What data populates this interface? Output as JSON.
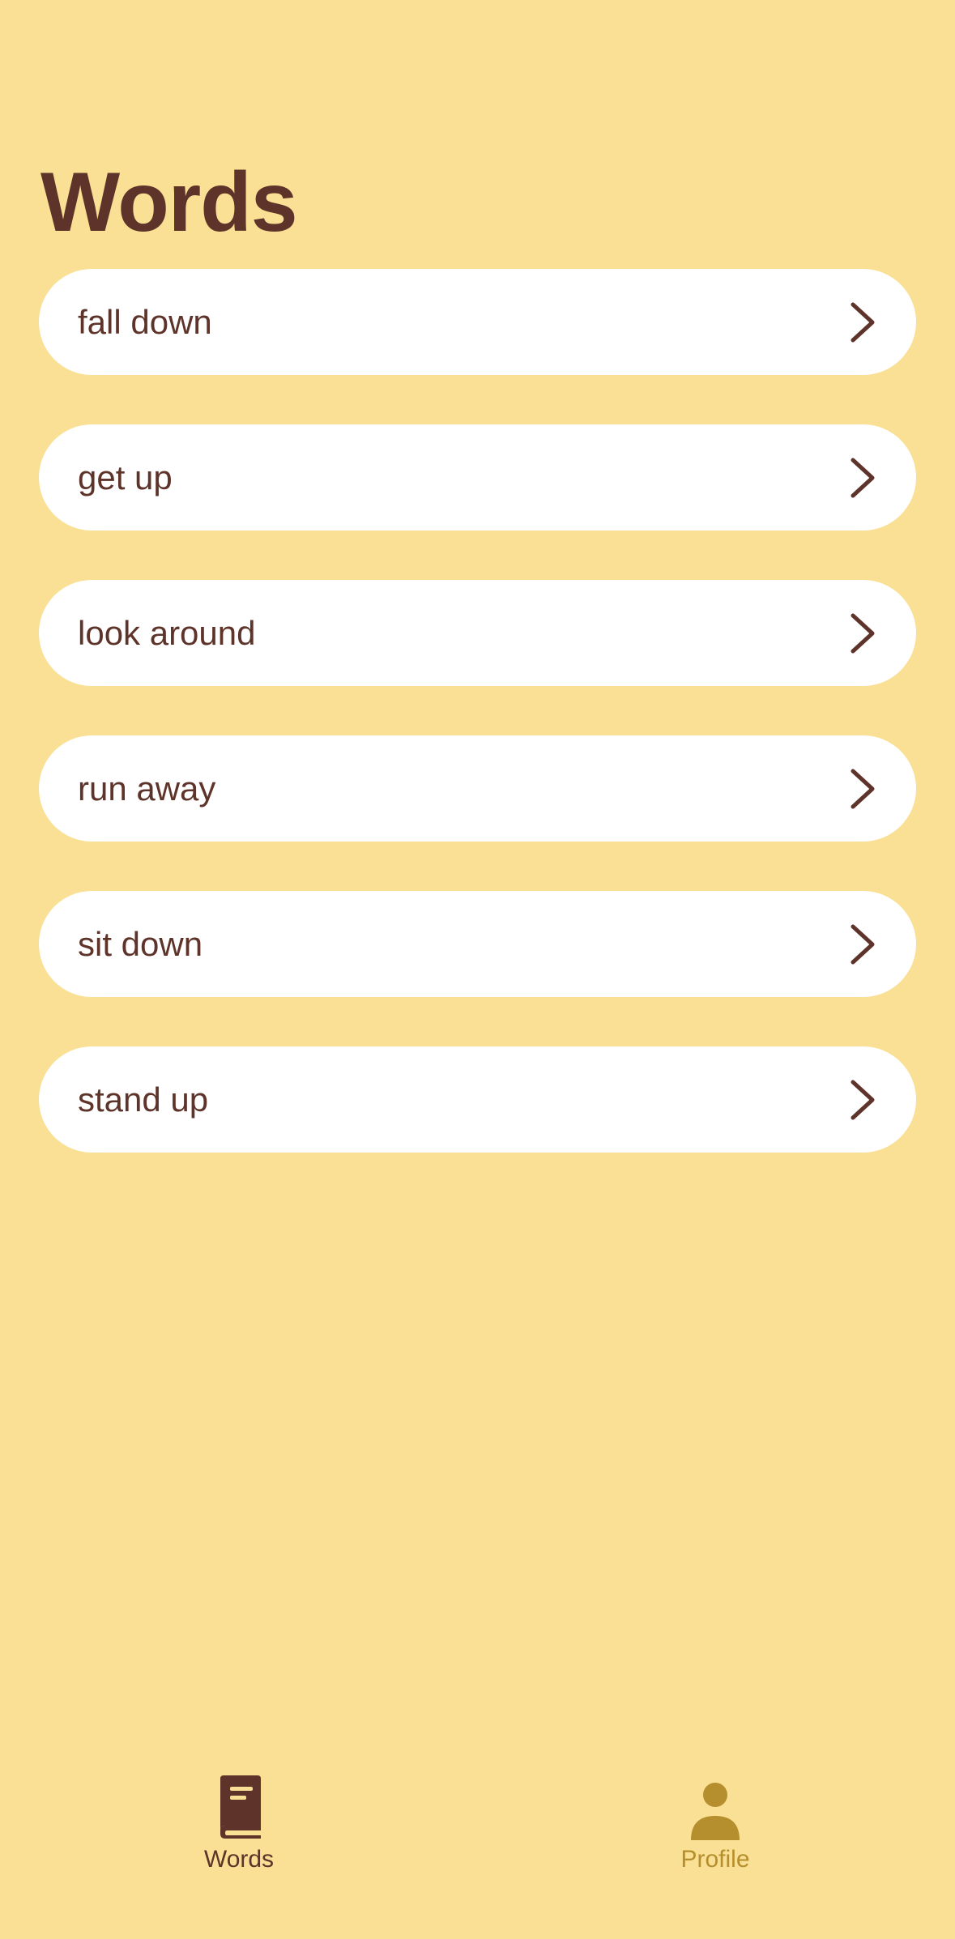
{
  "header": {
    "title": "Words"
  },
  "words": [
    {
      "label": "fall down",
      "icon": "chevron-right-icon"
    },
    {
      "label": "get up",
      "icon": "chevron-right-icon"
    },
    {
      "label": "look around",
      "icon": "chevron-right-icon"
    },
    {
      "label": "run away",
      "icon": "chevron-right-icon"
    },
    {
      "label": "sit down",
      "icon": "chevron-right-icon"
    },
    {
      "label": "stand up",
      "icon": "chevron-right-icon"
    }
  ],
  "tab_bar": {
    "tabs": [
      {
        "label": "Words",
        "icon": "book-icon",
        "active": true
      },
      {
        "label": "Profile",
        "icon": "person-icon",
        "active": false
      }
    ]
  },
  "colors": {
    "background": "#F9E094",
    "text_primary": "#5E342A",
    "card": "#FFFFFF",
    "tab_inactive": "#B58F2D"
  }
}
